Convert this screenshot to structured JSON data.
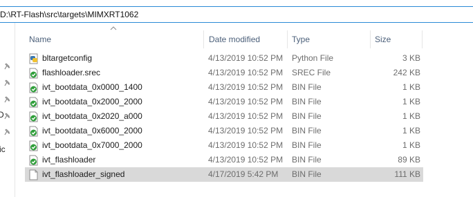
{
  "address_bar": {
    "path": "D:\\RT-Flash\\src\\targets\\MIMXRT1062"
  },
  "nav_pane": {
    "fragment_1": "D",
    "fragment_2": "ic",
    "pin_icons": [
      "pin-icon",
      "pin-icon",
      "pin-icon",
      "pin-icon",
      "pin-icon"
    ]
  },
  "columns": {
    "name": "Name",
    "date": "Date modified",
    "type": "Type",
    "size": "Size"
  },
  "files": [
    {
      "name": "bltargetconfig",
      "date": "4/13/2019 10:52 PM",
      "type": "Python File",
      "size": "3 KB",
      "icon": "python-file-icon"
    },
    {
      "name": "flashloader.srec",
      "date": "4/13/2019 10:52 PM",
      "type": "SREC File",
      "size": "242 KB",
      "icon": "checked-file-icon"
    },
    {
      "name": "ivt_bootdata_0x0000_1400",
      "date": "4/13/2019 10:52 PM",
      "type": "BIN File",
      "size": "1 KB",
      "icon": "checked-file-icon"
    },
    {
      "name": "ivt_bootdata_0x2000_2000",
      "date": "4/13/2019 10:52 PM",
      "type": "BIN File",
      "size": "1 KB",
      "icon": "checked-file-icon"
    },
    {
      "name": "ivt_bootdata_0x2020_a000",
      "date": "4/13/2019 10:52 PM",
      "type": "BIN File",
      "size": "1 KB",
      "icon": "checked-file-icon"
    },
    {
      "name": "ivt_bootdata_0x6000_2000",
      "date": "4/13/2019 10:52 PM",
      "type": "BIN File",
      "size": "1 KB",
      "icon": "checked-file-icon"
    },
    {
      "name": "ivt_bootdata_0x7000_2000",
      "date": "4/13/2019 10:52 PM",
      "type": "BIN File",
      "size": "1 KB",
      "icon": "checked-file-icon"
    },
    {
      "name": "ivt_flashloader",
      "date": "4/13/2019 10:52 PM",
      "type": "BIN File",
      "size": "89 KB",
      "icon": "checked-file-icon"
    },
    {
      "name": "ivt_flashloader_signed",
      "date": "4/17/2019 5:42 PM",
      "type": "BIN File",
      "size": "111 KB",
      "icon": "blank-file-icon"
    }
  ],
  "selected_file": "ivt_flashloader_signed"
}
